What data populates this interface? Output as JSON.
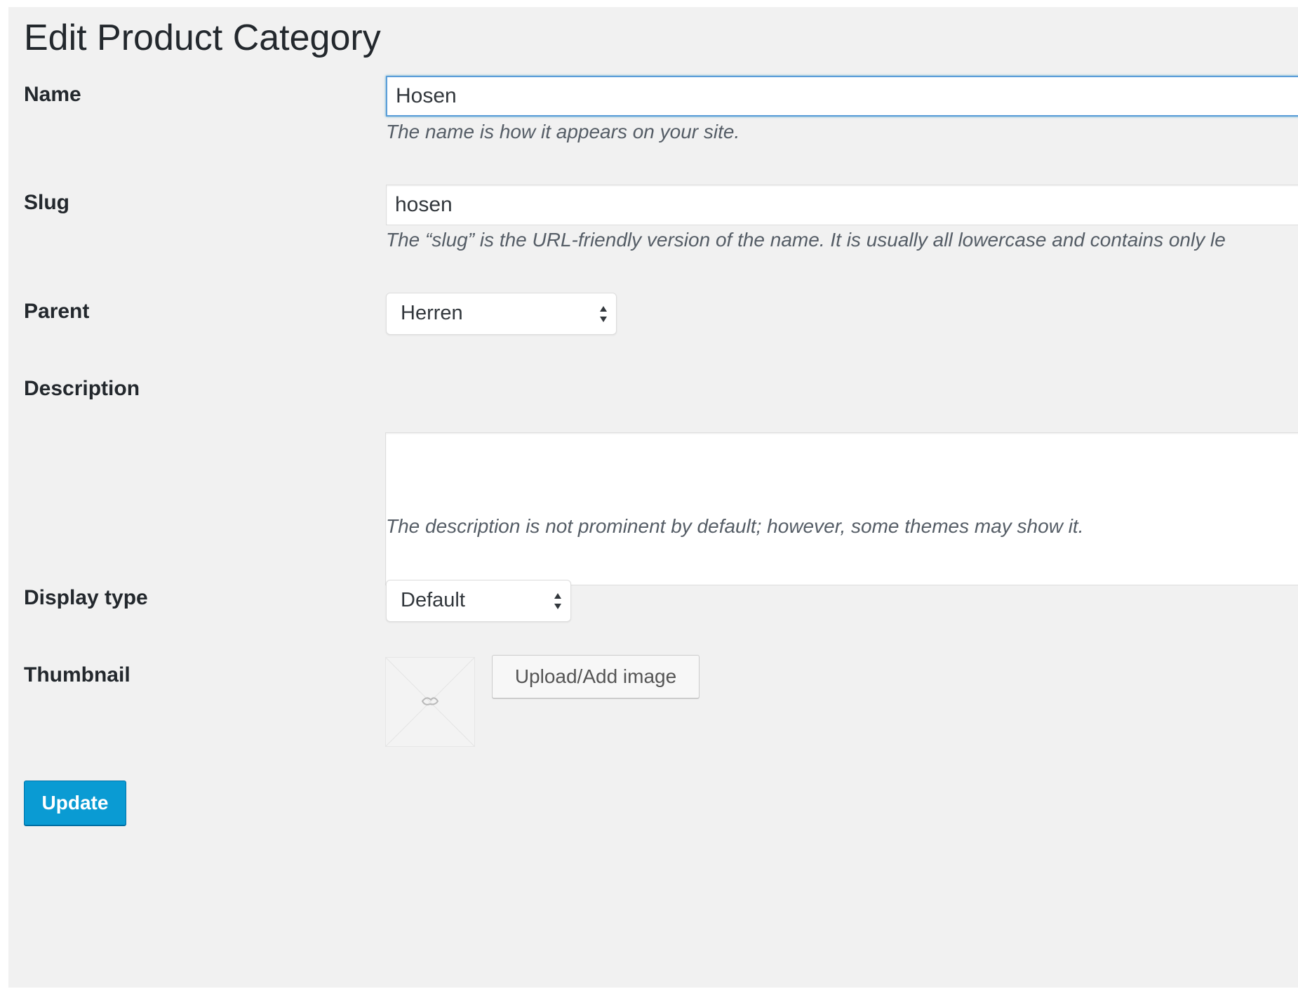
{
  "page": {
    "title": "Edit Product Category"
  },
  "form": {
    "name": {
      "label": "Name",
      "value": "Hosen",
      "help": "The name is how it appears on your site."
    },
    "slug": {
      "label": "Slug",
      "value": "hosen",
      "help": "The “slug” is the URL-friendly version of the name. It is usually all lowercase and contains only le"
    },
    "parent": {
      "label": "Parent",
      "selected": "Herren"
    },
    "description": {
      "label": "Description",
      "value": "",
      "help": "The description is not prominent by default; however, some themes may show it."
    },
    "display_type": {
      "label": "Display type",
      "selected": "Default"
    },
    "thumbnail": {
      "label": "Thumbnail",
      "placeholder_icon": "image-placeholder-icon",
      "upload_label": "Upload/Add image"
    }
  },
  "actions": {
    "update_label": "Update"
  },
  "colors": {
    "page_background": "#f1f1f1",
    "primary_button": "#0a9bd3",
    "focus_border": "#5b9dd9"
  }
}
